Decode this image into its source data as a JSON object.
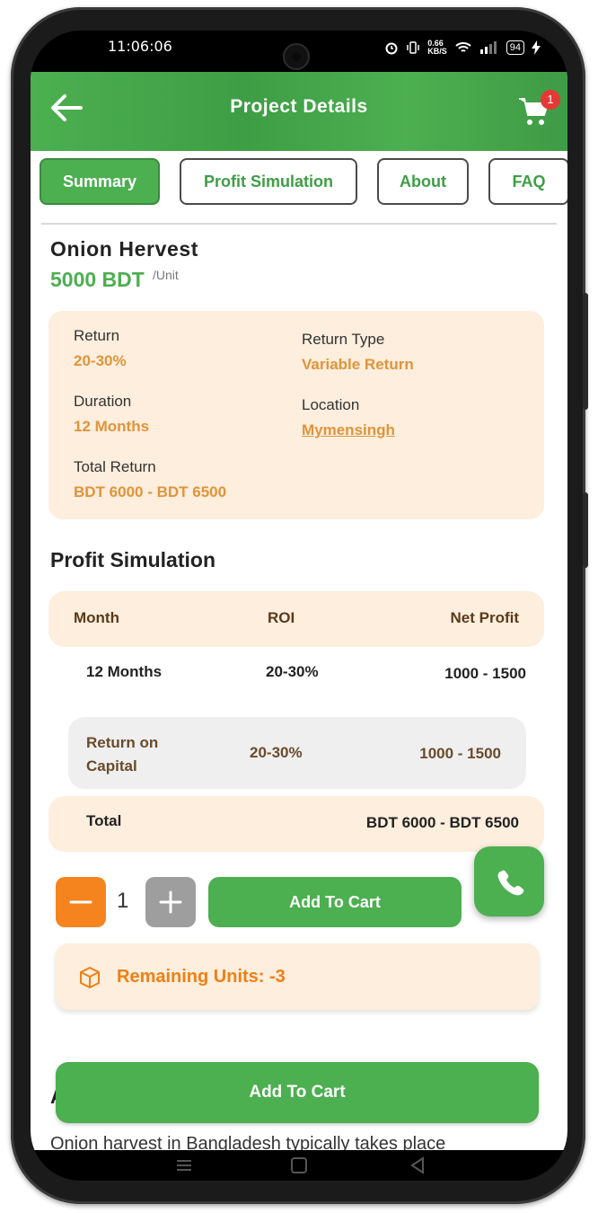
{
  "status": {
    "time": "11:06:06",
    "speed_top": "0.66",
    "speed_unit": "KB/S",
    "battery": "94"
  },
  "header": {
    "title": "Project Details",
    "cart_count": "1"
  },
  "tabs": [
    {
      "label": "Summary",
      "active": true
    },
    {
      "label": "Profit Simulation",
      "active": false
    },
    {
      "label": "About",
      "active": false
    },
    {
      "label": "FAQ",
      "active": false
    }
  ],
  "project": {
    "name": "Onion Hervest",
    "price": "5000 BDT",
    "unit": "/Unit"
  },
  "info": {
    "return_label": "Return",
    "return_value": "20-30%",
    "return_type_label": "Return Type",
    "return_type_value": "Variable Return",
    "duration_label": "Duration",
    "duration_value": "12 Months",
    "location_label": "Location",
    "location_value": "Mymensingh",
    "total_return_label": "Total Return",
    "total_return_value": "BDT 6000 - BDT 6500"
  },
  "simulation": {
    "title": "Profit Simulation",
    "headers": [
      "Month",
      "ROI",
      "Net Profit"
    ],
    "row": [
      "12 Months",
      "20-30%",
      "1000 - 1500"
    ],
    "roc": {
      "label": "Return on Capital",
      "roi": "20-30%",
      "profit": "1000 - 1500"
    },
    "total_label": "Total",
    "total_value": "BDT 6000 - BDT 6500"
  },
  "cart": {
    "quantity": "1",
    "add_label": "Add To Cart",
    "remaining": "Remaining Units: -3",
    "add_label_big": "Add To Cart"
  },
  "description": {
    "heading_peek": "A",
    "text": "Onion harvest in Bangladesh typically takes place"
  },
  "colors": {
    "primary": "#4caf50",
    "accent_orange": "#f5841f",
    "card_bg": "#fdeedd",
    "value_orange": "#e0943a"
  }
}
